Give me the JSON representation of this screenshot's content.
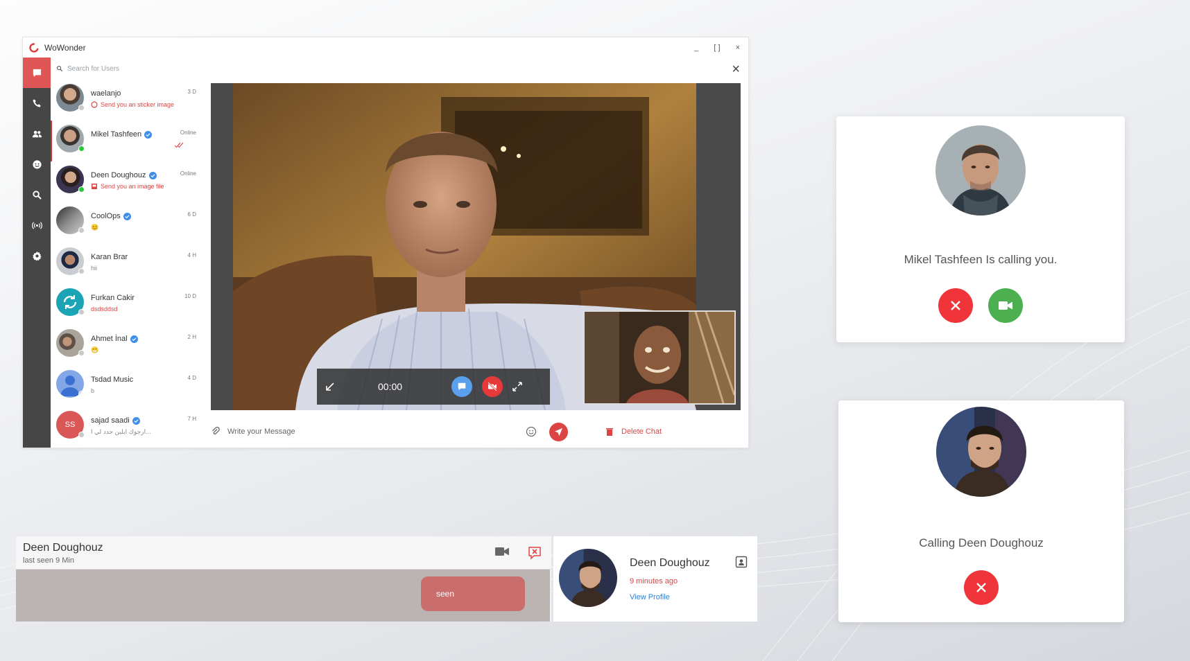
{
  "app": {
    "title": "WoWonder",
    "window_controls": [
      "_",
      "[ ]",
      "×"
    ],
    "search_placeholder": "Search for Users",
    "contacts": [
      {
        "name": "waelanjo",
        "sub": "Send you an sticker image",
        "time": "3 D",
        "verified": false,
        "status": "offline"
      },
      {
        "name": "Mikel Tashfeen",
        "sub": "",
        "time": "Online",
        "verified": true,
        "status": "online"
      },
      {
        "name": "Deen Doughouz",
        "sub": "Send you an image file",
        "time": "Online",
        "verified": true,
        "status": "online"
      },
      {
        "name": "CoolOps",
        "sub": "😊",
        "time": "6 D",
        "verified": true,
        "status": "offline"
      },
      {
        "name": "Karan Brar",
        "sub": "hii",
        "time": "4 H",
        "verified": false,
        "status": "offline"
      },
      {
        "name": "Furkan Cakir",
        "sub": "dsdsddsd",
        "time": "10 D",
        "verified": false,
        "status": "offline"
      },
      {
        "name": "Ahmet İnal",
        "sub": "😁",
        "time": "2 H",
        "verified": true,
        "status": "offline"
      },
      {
        "name": "Tsdad Music",
        "sub": "b",
        "time": "4 D",
        "verified": false,
        "status": "offline"
      },
      {
        "name": "sajad saadi",
        "sub": "ارجوك ابلين حدد لي ا...",
        "time": "7 H",
        "verified": true,
        "status": "offline",
        "initials": "SS"
      }
    ],
    "video": {
      "timer": "00:00"
    },
    "composer_placeholder": "Write your Message",
    "delete_chat": "Delete Chat"
  },
  "incoming_call": {
    "text": "Mikel Tashfeen Is calling you."
  },
  "outgoing_call": {
    "text": "Calling Deen Doughouz"
  },
  "chat_strip": {
    "name": "Deen Doughouz",
    "last_seen": "last seen 9 Min",
    "bubble": "seen"
  },
  "profile_card": {
    "name": "Deen Doughouz",
    "ago": "9 minutes ago",
    "link": "View Profile"
  },
  "colors": {
    "accent": "#e05555",
    "rail": "#464646",
    "online": "#31c43b",
    "decline": "#f0353a",
    "accept": "#4cb050",
    "link": "#2f7fd8"
  }
}
